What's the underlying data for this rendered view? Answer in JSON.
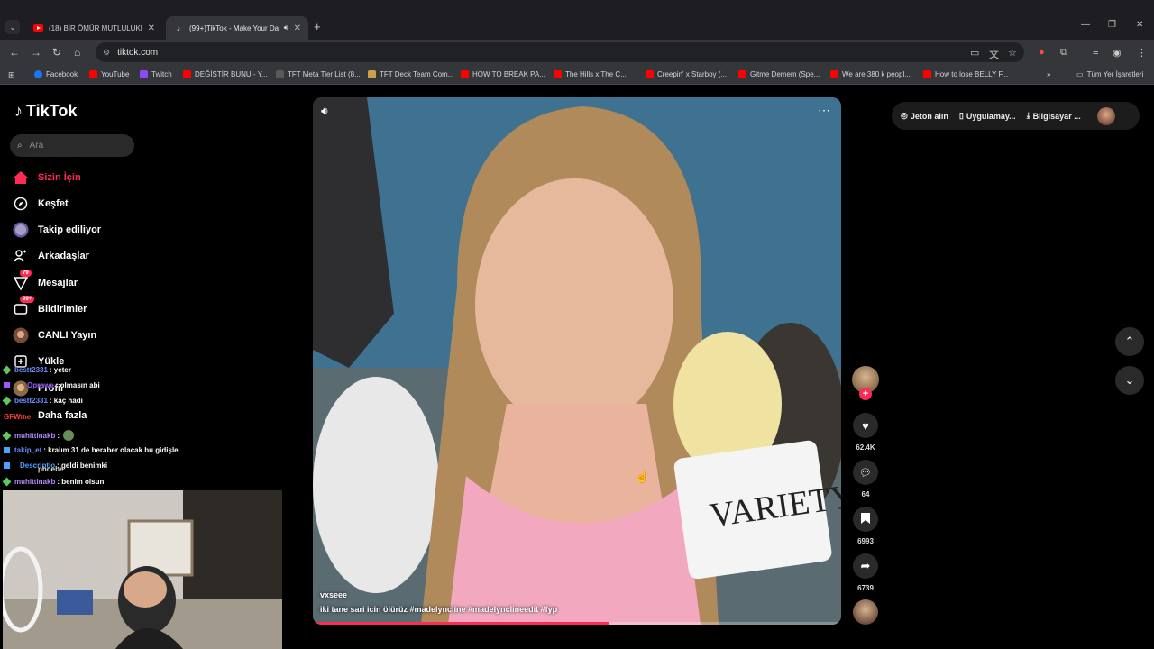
{
  "browser": {
    "tabs": [
      {
        "label": "(18) BİR ÖMÜR MUTLULUKLAR",
        "icon": "youtube-icon"
      },
      {
        "label": "(99+)TikTok - Make Your Da",
        "icon": "tiktok-icon"
      }
    ],
    "url": "tiktok.com",
    "bookmarks": [
      "Facebook",
      "YouTube",
      "Twitch",
      "DEĞİŞTİR BUNU - Y...",
      "TFT Meta Tier List (8...",
      "TFT Deck Team Com...",
      "HOW TO BREAK PA...",
      "The Hills x The C...",
      "Creepin' x Starboy (...",
      "Gitme Demem (Spe...",
      "We are 380 k peopl...",
      "How to lose BELLY F..."
    ],
    "all_bookmarks": "Tüm Yer İşaretleri"
  },
  "tiktok": {
    "brand": "TikTok",
    "search_placeholder": "Ara",
    "nav": [
      {
        "label": "Sizin İçin",
        "icon": "home-icon"
      },
      {
        "label": "Keşfet",
        "icon": "compass-icon"
      },
      {
        "label": "Takip ediliyor",
        "icon": "following-avatar-icon"
      },
      {
        "label": "Arkadaşlar",
        "icon": "friends-icon"
      },
      {
        "label": "Mesajlar",
        "icon": "messages-icon",
        "badge": "79"
      },
      {
        "label": "Bildirimler",
        "icon": "notifications-icon",
        "badge": "99+"
      },
      {
        "label": "CANLI Yayın",
        "icon": "live-icon"
      },
      {
        "label": "Yükle",
        "icon": "upload-icon"
      }
    ],
    "nav_profile": "Profil",
    "nav_more": "Daha fazla",
    "video": {
      "username": "vxseee",
      "caption": "iki tane sari icin ölürüz #madelyncline #madelynclineedit #fyp",
      "progress": 0.56
    },
    "actions": {
      "likes": "62.4K",
      "comments": "64",
      "saves": "6993",
      "shares": "6739"
    },
    "topright": {
      "coins": "Jeton alın",
      "app": "Uygulamay...",
      "desktop": "Bilgisayar ..."
    }
  },
  "chat": [
    {
      "user": "bestt2331",
      "msg": ": yeter",
      "color": "#6b8cff"
    },
    {
      "user": "Oprowe",
      "msg": ": olmasın abi",
      "color": "#9b59ff"
    },
    {
      "user": "bestt2331",
      "msg": ": kaç hadi",
      "color": "#6b8cff"
    },
    {
      "user": "GFWme",
      "msg": "",
      "color": "#ff3b3b"
    },
    {
      "user": "muhittinakb",
      "msg": ":",
      "color": "#b388ff"
    },
    {
      "user": "takip_et",
      "msg": ": kralım 31 de beraber olacak bu gidişle",
      "color": "#6b8cff"
    },
    {
      "user": "Descriptio",
      "msg": ": geldi benimki",
      "color": "#4aa3ff"
    },
    {
      "user": "muhittinakb",
      "msg": ": benim olsun",
      "color": "#b388ff"
    }
  ],
  "phoebe": "phoebe"
}
